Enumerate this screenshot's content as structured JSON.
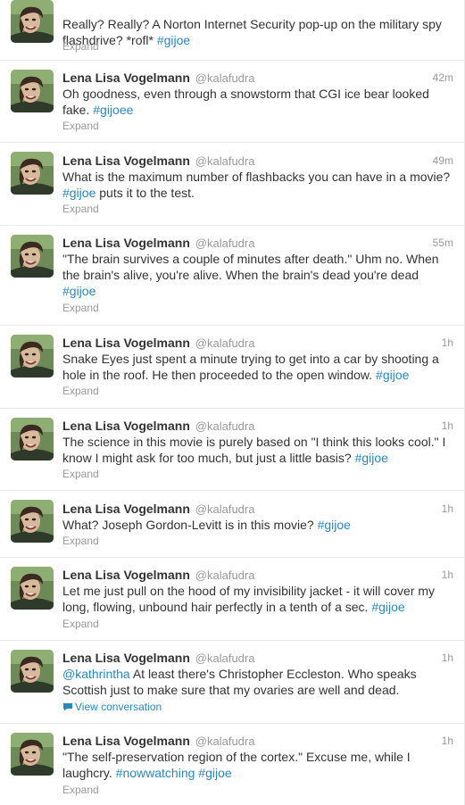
{
  "tweets": [
    {
      "show_header": false,
      "time": "",
      "parts": [
        {
          "type": "text",
          "text": "Really? Really? A Norton Internet Security pop-up on the military spy flashdrive? *rofl* "
        },
        {
          "type": "hashtag",
          "text": "#gijoe"
        }
      ],
      "action": "Expand"
    },
    {
      "show_header": true,
      "time": "42m",
      "parts": [
        {
          "type": "text",
          "text": "Oh goodness, even through a snowstorm that CGI ice bear looked fake. "
        },
        {
          "type": "hashtag",
          "text": "#gijoee"
        }
      ],
      "action": "Expand"
    },
    {
      "show_header": true,
      "time": "49m",
      "parts": [
        {
          "type": "text",
          "text": "What is the maximum number of flashbacks you can have in a movie? "
        },
        {
          "type": "hashtag",
          "text": "#gijoe"
        },
        {
          "type": "text",
          "text": " puts it to the test."
        }
      ],
      "action": "Expand"
    },
    {
      "show_header": true,
      "time": "55m",
      "parts": [
        {
          "type": "text",
          "text": "\"The brain survives a couple of minutes after death.\" Uhm no. When the brain's alive, you're alive. When the brain's dead you're dead "
        },
        {
          "type": "hashtag",
          "text": "#gijoe"
        }
      ],
      "action": "Expand"
    },
    {
      "show_header": true,
      "time": "1h",
      "parts": [
        {
          "type": "text",
          "text": "Snake Eyes just spent a minute trying to get into a car by shooting a hole in the roof. He then proceeded to the open window. "
        },
        {
          "type": "hashtag",
          "text": "#gijoe"
        }
      ],
      "action": "Expand"
    },
    {
      "show_header": true,
      "time": "1h",
      "parts": [
        {
          "type": "text",
          "text": "The science in this movie is purely based on \"I think this looks cool.\" I know I might ask for too much, but just a little basis? "
        },
        {
          "type": "hashtag",
          "text": "#gijoe"
        }
      ],
      "action": "Expand"
    },
    {
      "show_header": true,
      "time": "1h",
      "parts": [
        {
          "type": "text",
          "text": "What? Joseph Gordon-Levitt is in this movie? "
        },
        {
          "type": "hashtag",
          "text": "#gijoe"
        }
      ],
      "action": "Expand"
    },
    {
      "show_header": true,
      "time": "1h",
      "parts": [
        {
          "type": "text",
          "text": "Let me just pull on the hood of my invisibility jacket - it will cover my long, flowing, unbound hair perfectly in a tenth of a sec. "
        },
        {
          "type": "hashtag",
          "text": "#gijoe"
        }
      ],
      "action": "Expand"
    },
    {
      "show_header": true,
      "time": "1h",
      "parts": [
        {
          "type": "mention",
          "text": "@kathrintha"
        },
        {
          "type": "text",
          "text": " At least there's Christopher Eccleston. Who speaks Scottish just to make sure that my ovaries are well and dead."
        }
      ],
      "action": "View conversation",
      "action_icon": "speech-bubble-icon"
    },
    {
      "show_header": true,
      "time": "1h",
      "parts": [
        {
          "type": "text",
          "text": "\"The self-preservation region of the cortex.\" Excuse me, while I laughcry. "
        },
        {
          "type": "hashtag",
          "text": "#nowwatching"
        },
        {
          "type": "text",
          "text": " "
        },
        {
          "type": "hashtag",
          "text": "#gijoe"
        }
      ],
      "action": "Expand"
    }
  ],
  "author": {
    "fullname": "Lena Lisa Vogelmann",
    "handle": "@kalafudra",
    "avatar_icon": "user-avatar"
  },
  "colors": {
    "link": "#2a87bc",
    "muted": "#999999",
    "text": "#333333",
    "divider": "#e8e8e8"
  }
}
